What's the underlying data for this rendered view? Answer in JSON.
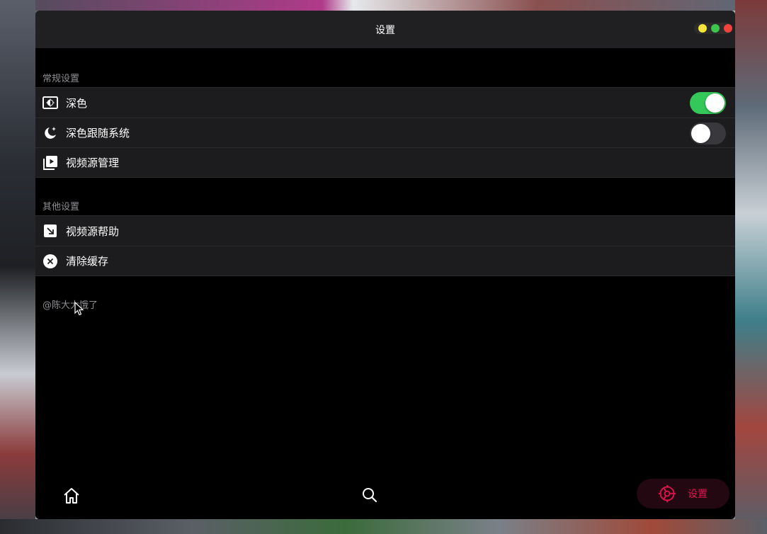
{
  "window": {
    "title": "设置"
  },
  "sections": [
    {
      "header": "常规设置",
      "rows": [
        {
          "label": "深色",
          "icon": "display-brightness-icon",
          "toggle": true
        },
        {
          "label": "深色跟随系统",
          "icon": "moon-stars-icon",
          "toggle": false
        },
        {
          "label": "视频源管理",
          "icon": "video-library-icon"
        }
      ]
    },
    {
      "header": "其他设置",
      "rows": [
        {
          "label": "视频源帮助",
          "icon": "arrow-down-right-square-icon"
        },
        {
          "label": "清除缓存",
          "icon": "x-circle-icon"
        }
      ]
    }
  ],
  "credit": "@陈大大饿了",
  "tabbar": {
    "home_icon": "home-icon",
    "search_icon": "search-icon",
    "settings_icon": "gear-icon",
    "settings_label": "设置",
    "active_color": "#e5124f"
  },
  "colors": {
    "toggle_on": "#34c759",
    "toggle_off": "#39393d",
    "traffic_yellow": "#f5e43a",
    "traffic_green": "#3fc54e",
    "traffic_red": "#f0433e"
  }
}
